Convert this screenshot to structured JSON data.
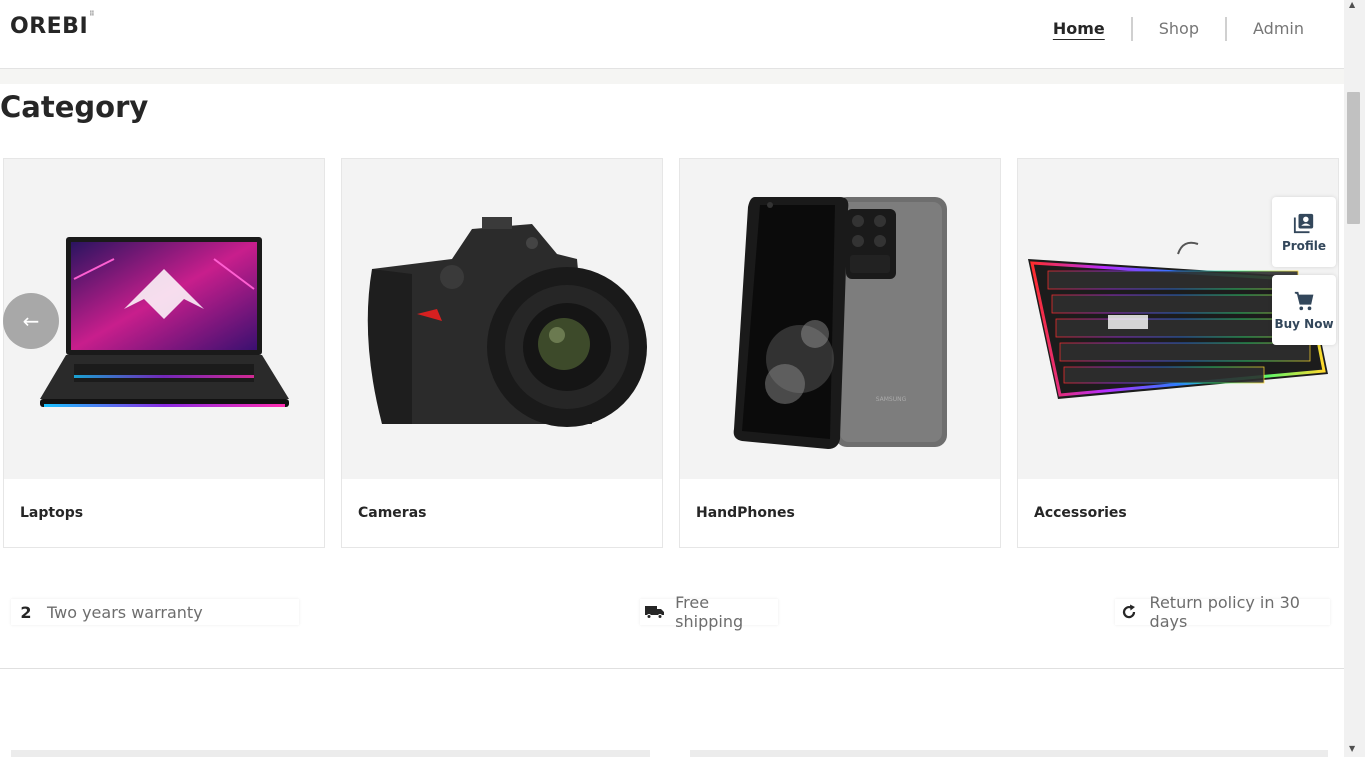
{
  "header": {
    "logo": "OREBI",
    "nav": [
      {
        "label": "Home",
        "active": true
      },
      {
        "label": "Shop",
        "active": false
      },
      {
        "label": "Admin",
        "active": false
      }
    ]
  },
  "category": {
    "title": "Category",
    "cards": [
      {
        "label": "Laptops",
        "image": "laptop-image"
      },
      {
        "label": "Cameras",
        "image": "camera-image"
      },
      {
        "label": "HandPhones",
        "image": "smartphone-image"
      },
      {
        "label": "Accessories",
        "image": "keyboard-image"
      }
    ],
    "prev_arrow": "←"
  },
  "side_buttons": {
    "profile": "Profile",
    "buy_now": "Buy Now"
  },
  "features": {
    "warranty_number": "2",
    "warranty": "Two years warranty",
    "shipping": "Free shipping",
    "returns": "Return policy in 30 days"
  },
  "colors": {
    "text": "#262626",
    "muted": "#767676",
    "card_bg": "#f3f3f3",
    "arrow_bg": "#a8a8a8"
  }
}
